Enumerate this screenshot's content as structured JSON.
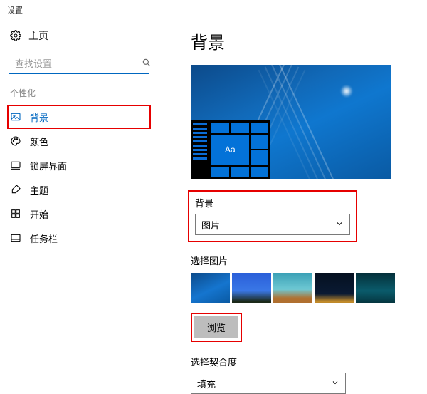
{
  "window": {
    "title": "设置"
  },
  "sidebar": {
    "home": "主页",
    "search_placeholder": "查找设置",
    "section": "个性化",
    "items": [
      {
        "label": "背景",
        "icon": "picture-icon",
        "selected": true
      },
      {
        "label": "颜色",
        "icon": "palette-icon",
        "selected": false
      },
      {
        "label": "锁屏界面",
        "icon": "lock-screen-icon",
        "selected": false
      },
      {
        "label": "主题",
        "icon": "theme-icon",
        "selected": false
      },
      {
        "label": "开始",
        "icon": "start-icon",
        "selected": false
      },
      {
        "label": "任务栏",
        "icon": "taskbar-icon",
        "selected": false
      }
    ]
  },
  "main": {
    "title": "背景",
    "preview_sample_text": "Aa",
    "bg_section": {
      "label": "背景",
      "value": "图片"
    },
    "choose_picture_label": "选择图片",
    "browse_label": "浏览",
    "fit_section": {
      "label": "选择契合度",
      "value": "填充"
    }
  },
  "colors": {
    "accent": "#0067c0",
    "highlight": "#e60000"
  }
}
